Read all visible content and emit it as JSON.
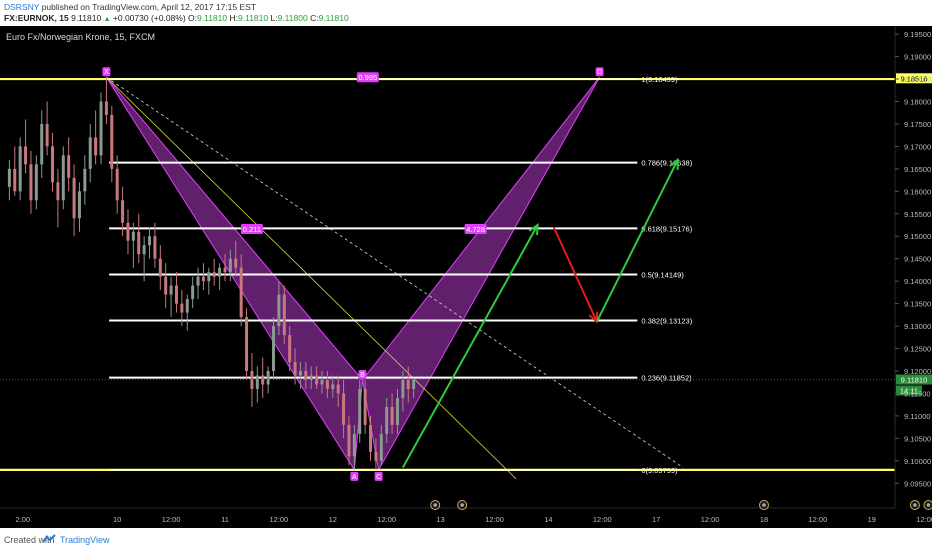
{
  "header": {
    "user": "DSRSNY",
    "published": "published on TradingView.com, April 12, 2017 17:15 EST",
    "symbol": "FX:EURNOK, 15",
    "last": "9.11810",
    "change": "+0.00730 (+0.08%)",
    "o_label": "O:",
    "o_value": "9.11810",
    "h_label": "H:",
    "h_value": "9.11810",
    "l_label": "L:",
    "l_value": "9.11800",
    "c_label": "C:",
    "c_value": "9.11810"
  },
  "footer": {
    "created_with": "Created with",
    "brand": "TradingView"
  },
  "colors": {
    "background": "#000000",
    "candle_up": "#8a9a92",
    "candle_down": "#c9787e",
    "pattern_fill": "#b03bc2",
    "pattern_line": "#e040fb",
    "level_white": "#ffffff",
    "level_yellow": "#ffff66",
    "arrow_green": "#2ecc40",
    "arrow_red": "#e21b1b",
    "price_tag": "#2a8c3a"
  },
  "chart_data": {
    "type": "candlestick",
    "title": "Euro Fx/Norwegian Krone, 15, FXCM",
    "price_axis": {
      "ylim": [
        9.0895,
        9.1968
      ],
      "ticks": [
        "9.19500",
        "9.19000",
        "9.18500",
        "9.18000",
        "9.17500",
        "9.17000",
        "9.16500",
        "9.16000",
        "9.15500",
        "9.15000",
        "9.14500",
        "9.14000",
        "9.13500",
        "9.13000",
        "9.12500",
        "9.12000",
        "9.11500",
        "9.11000",
        "9.10500",
        "9.10000",
        "9.09500"
      ],
      "tick_values": [
        9.195,
        9.19,
        9.185,
        9.18,
        9.175,
        9.17,
        9.165,
        9.16,
        9.155,
        9.15,
        9.145,
        9.14,
        9.135,
        9.13,
        9.125,
        9.12,
        9.115,
        9.11,
        9.105,
        9.1,
        9.095
      ],
      "current_price": "9.11810",
      "current_value": 9.1181,
      "top_level_tag": "9.18516",
      "top_level_value": 9.18516,
      "countdown": "14:11"
    },
    "time_axis": {
      "labels": [
        "2:00",
        "10",
        "12:00",
        "11",
        "12:00",
        "12",
        "12:00",
        "13",
        "12:00",
        "14",
        "12:00",
        "17",
        "12:00",
        "18",
        "12:00",
        "19",
        "12:00"
      ],
      "positions": [
        -1.5,
        2,
        4,
        6,
        8,
        10,
        12,
        14,
        16,
        18,
        20,
        22,
        24,
        26,
        28,
        30,
        32
      ]
    },
    "fibonacci_levels": [
      {
        "ratio": "1",
        "value": 9.18499,
        "label": "1(9.18499)"
      },
      {
        "ratio": "0.786",
        "value": 9.16638,
        "label": "0.786(9.16638)"
      },
      {
        "ratio": "0.618",
        "value": 9.15176,
        "label": "0.618(9.15176)"
      },
      {
        "ratio": "0.5",
        "value": 9.14149,
        "label": "0.5(9.14149)"
      },
      {
        "ratio": "0.382",
        "value": 9.13123,
        "label": "0.382(9.13123)"
      },
      {
        "ratio": "0.236",
        "value": 9.11852,
        "label": "0.236(9.11852)"
      },
      {
        "ratio": "0",
        "value": 9.09799,
        "label": "0(9.09799)"
      }
    ],
    "pattern_points": [
      {
        "name": "X",
        "t": 1.6,
        "price": 9.1854
      },
      {
        "name": "A",
        "t": 10.8,
        "price": 9.098
      },
      {
        "name": "B",
        "t": 11.1,
        "price": 9.118
      },
      {
        "name": "C",
        "t": 11.7,
        "price": 9.098
      },
      {
        "name": "D",
        "t": 19.9,
        "price": 9.1854
      }
    ],
    "pattern_ratios": [
      {
        "label": "0.211",
        "t": 7.0,
        "price": 9.1516
      },
      {
        "label": "4.728",
        "t": 15.3,
        "price": 9.1516
      },
      {
        "label": "0.995",
        "t": 11.3,
        "price": 9.1854
      }
    ],
    "arrows": [
      {
        "color": "green",
        "from": {
          "t": 12.6,
          "price": 9.0985
        },
        "to": {
          "t": 17.6,
          "price": 9.1525
        }
      },
      {
        "color": "red",
        "from": {
          "t": 18.2,
          "price": 9.152
        },
        "to": {
          "t": 19.8,
          "price": 9.131
        }
      },
      {
        "color": "green",
        "from": {
          "t": 19.8,
          "price": 9.131
        },
        "to": {
          "t": 22.8,
          "price": 9.167
        }
      }
    ],
    "trendlines": [
      {
        "style": "dashed",
        "from": {
          "t": 1.6,
          "price": 9.1854
        },
        "to": {
          "t": 23.0,
          "price": 9.0985
        }
      },
      {
        "style": "solid",
        "from": {
          "t": 1.6,
          "price": 9.1854
        },
        "to": {
          "t": 16.8,
          "price": 9.096
        }
      }
    ],
    "candles": [
      {
        "t": -2.0,
        "o": 9.161,
        "h": 9.167,
        "l": 9.158,
        "c": 9.165
      },
      {
        "t": -1.8,
        "o": 9.165,
        "h": 9.17,
        "l": 9.159,
        "c": 9.16
      },
      {
        "t": -1.6,
        "o": 9.16,
        "h": 9.172,
        "l": 9.158,
        "c": 9.17
      },
      {
        "t": -1.4,
        "o": 9.17,
        "h": 9.176,
        "l": 9.164,
        "c": 9.166
      },
      {
        "t": -1.2,
        "o": 9.166,
        "h": 9.169,
        "l": 9.155,
        "c": 9.158
      },
      {
        "t": -1.0,
        "o": 9.158,
        "h": 9.168,
        "l": 9.156,
        "c": 9.166
      },
      {
        "t": -0.8,
        "o": 9.166,
        "h": 9.178,
        "l": 9.163,
        "c": 9.175
      },
      {
        "t": -0.6,
        "o": 9.175,
        "h": 9.18,
        "l": 9.168,
        "c": 9.17
      },
      {
        "t": -0.4,
        "o": 9.17,
        "h": 9.173,
        "l": 9.16,
        "c": 9.162
      },
      {
        "t": -0.2,
        "o": 9.162,
        "h": 9.165,
        "l": 9.152,
        "c": 9.158
      },
      {
        "t": 0.0,
        "o": 9.158,
        "h": 9.17,
        "l": 9.156,
        "c": 9.168
      },
      {
        "t": 0.2,
        "o": 9.168,
        "h": 9.172,
        "l": 9.16,
        "c": 9.163
      },
      {
        "t": 0.4,
        "o": 9.163,
        "h": 9.166,
        "l": 9.15,
        "c": 9.154
      },
      {
        "t": 0.6,
        "o": 9.154,
        "h": 9.162,
        "l": 9.151,
        "c": 9.16
      },
      {
        "t": 0.8,
        "o": 9.16,
        "h": 9.168,
        "l": 9.157,
        "c": 9.165
      },
      {
        "t": 1.0,
        "o": 9.165,
        "h": 9.175,
        "l": 9.162,
        "c": 9.172
      },
      {
        "t": 1.2,
        "o": 9.172,
        "h": 9.178,
        "l": 9.166,
        "c": 9.168
      },
      {
        "t": 1.4,
        "o": 9.168,
        "h": 9.182,
        "l": 9.166,
        "c": 9.18
      },
      {
        "t": 1.6,
        "o": 9.18,
        "h": 9.1854,
        "l": 9.175,
        "c": 9.177
      },
      {
        "t": 1.8,
        "o": 9.177,
        "h": 9.179,
        "l": 9.162,
        "c": 9.165
      },
      {
        "t": 2.0,
        "o": 9.165,
        "h": 9.168,
        "l": 9.155,
        "c": 9.158
      },
      {
        "t": 2.2,
        "o": 9.158,
        "h": 9.161,
        "l": 9.15,
        "c": 9.153
      },
      {
        "t": 2.4,
        "o": 9.153,
        "h": 9.156,
        "l": 9.146,
        "c": 9.149
      },
      {
        "t": 2.6,
        "o": 9.149,
        "h": 9.153,
        "l": 9.143,
        "c": 9.151
      },
      {
        "t": 2.8,
        "o": 9.151,
        "h": 9.155,
        "l": 9.144,
        "c": 9.146
      },
      {
        "t": 3.0,
        "o": 9.146,
        "h": 9.15,
        "l": 9.14,
        "c": 9.148
      },
      {
        "t": 3.2,
        "o": 9.148,
        "h": 9.152,
        "l": 9.145,
        "c": 9.15
      },
      {
        "t": 3.4,
        "o": 9.15,
        "h": 9.153,
        "l": 9.143,
        "c": 9.145
      },
      {
        "t": 3.6,
        "o": 9.145,
        "h": 9.148,
        "l": 9.138,
        "c": 9.141
      },
      {
        "t": 3.8,
        "o": 9.141,
        "h": 9.144,
        "l": 9.134,
        "c": 9.137
      },
      {
        "t": 4.0,
        "o": 9.137,
        "h": 9.141,
        "l": 9.132,
        "c": 9.139
      },
      {
        "t": 4.2,
        "o": 9.139,
        "h": 9.142,
        "l": 9.133,
        "c": 9.135
      },
      {
        "t": 4.4,
        "o": 9.135,
        "h": 9.138,
        "l": 9.13,
        "c": 9.133
      },
      {
        "t": 4.6,
        "o": 9.133,
        "h": 9.137,
        "l": 9.129,
        "c": 9.136
      },
      {
        "t": 4.8,
        "o": 9.136,
        "h": 9.141,
        "l": 9.134,
        "c": 9.139
      },
      {
        "t": 5.0,
        "o": 9.139,
        "h": 9.143,
        "l": 9.136,
        "c": 9.141
      },
      {
        "t": 5.2,
        "o": 9.141,
        "h": 9.144,
        "l": 9.138,
        "c": 9.14
      },
      {
        "t": 5.4,
        "o": 9.14,
        "h": 9.143,
        "l": 9.137,
        "c": 9.142
      },
      {
        "t": 5.6,
        "o": 9.142,
        "h": 9.145,
        "l": 9.139,
        "c": 9.141
      },
      {
        "t": 5.8,
        "o": 9.141,
        "h": 9.144,
        "l": 9.138,
        "c": 9.143
      },
      {
        "t": 6.0,
        "o": 9.143,
        "h": 9.146,
        "l": 9.14,
        "c": 9.142
      },
      {
        "t": 6.2,
        "o": 9.142,
        "h": 9.147,
        "l": 9.14,
        "c": 9.145
      },
      {
        "t": 6.4,
        "o": 9.145,
        "h": 9.149,
        "l": 9.141,
        "c": 9.143
      },
      {
        "t": 6.6,
        "o": 9.143,
        "h": 9.146,
        "l": 9.13,
        "c": 9.132
      },
      {
        "t": 6.8,
        "o": 9.132,
        "h": 9.134,
        "l": 9.118,
        "c": 9.12
      },
      {
        "t": 7.0,
        "o": 9.12,
        "h": 9.124,
        "l": 9.112,
        "c": 9.116
      },
      {
        "t": 7.2,
        "o": 9.116,
        "h": 9.121,
        "l": 9.113,
        "c": 9.119
      },
      {
        "t": 7.4,
        "o": 9.119,
        "h": 9.123,
        "l": 9.114,
        "c": 9.117
      },
      {
        "t": 7.6,
        "o": 9.117,
        "h": 9.121,
        "l": 9.115,
        "c": 9.12
      },
      {
        "t": 7.8,
        "o": 9.12,
        "h": 9.132,
        "l": 9.118,
        "c": 9.13
      },
      {
        "t": 8.0,
        "o": 9.13,
        "h": 9.14,
        "l": 9.128,
        "c": 9.137
      },
      {
        "t": 8.2,
        "o": 9.137,
        "h": 9.139,
        "l": 9.126,
        "c": 9.128
      },
      {
        "t": 8.4,
        "o": 9.128,
        "h": 9.13,
        "l": 9.12,
        "c": 9.122
      },
      {
        "t": 8.6,
        "o": 9.122,
        "h": 9.125,
        "l": 9.117,
        "c": 9.119
      },
      {
        "t": 8.8,
        "o": 9.119,
        "h": 9.122,
        "l": 9.116,
        "c": 9.12
      },
      {
        "t": 9.0,
        "o": 9.12,
        "h": 9.122,
        "l": 9.116,
        "c": 9.118
      },
      {
        "t": 9.2,
        "o": 9.118,
        "h": 9.121,
        "l": 9.116,
        "c": 9.119
      },
      {
        "t": 9.4,
        "o": 9.119,
        "h": 9.121,
        "l": 9.116,
        "c": 9.117
      },
      {
        "t": 9.6,
        "o": 9.117,
        "h": 9.12,
        "l": 9.115,
        "c": 9.118
      },
      {
        "t": 9.8,
        "o": 9.118,
        "h": 9.12,
        "l": 9.114,
        "c": 9.116
      },
      {
        "t": 10.0,
        "o": 9.116,
        "h": 9.119,
        "l": 9.114,
        "c": 9.117
      },
      {
        "t": 10.2,
        "o": 9.117,
        "h": 9.119,
        "l": 9.112,
        "c": 9.115
      },
      {
        "t": 10.4,
        "o": 9.115,
        "h": 9.118,
        "l": 9.105,
        "c": 9.108
      },
      {
        "t": 10.6,
        "o": 9.108,
        "h": 9.11,
        "l": 9.099,
        "c": 9.101
      },
      {
        "t": 10.8,
        "o": 9.101,
        "h": 9.108,
        "l": 9.098,
        "c": 9.106
      },
      {
        "t": 11.0,
        "o": 9.106,
        "h": 9.118,
        "l": 9.104,
        "c": 9.116
      },
      {
        "t": 11.2,
        "o": 9.116,
        "h": 9.118,
        "l": 9.106,
        "c": 9.108
      },
      {
        "t": 11.4,
        "o": 9.108,
        "h": 9.11,
        "l": 9.1,
        "c": 9.102
      },
      {
        "t": 11.6,
        "o": 9.102,
        "h": 9.105,
        "l": 9.098,
        "c": 9.1
      },
      {
        "t": 11.8,
        "o": 9.1,
        "h": 9.108,
        "l": 9.099,
        "c": 9.106
      },
      {
        "t": 12.0,
        "o": 9.106,
        "h": 9.114,
        "l": 9.104,
        "c": 9.112
      },
      {
        "t": 12.2,
        "o": 9.112,
        "h": 9.115,
        "l": 9.106,
        "c": 9.108
      },
      {
        "t": 12.4,
        "o": 9.108,
        "h": 9.116,
        "l": 9.106,
        "c": 9.114
      },
      {
        "t": 12.6,
        "o": 9.114,
        "h": 9.12,
        "l": 9.111,
        "c": 9.118
      },
      {
        "t": 12.8,
        "o": 9.118,
        "h": 9.121,
        "l": 9.113,
        "c": 9.116
      },
      {
        "t": 13.0,
        "o": 9.116,
        "h": 9.1185,
        "l": 9.114,
        "c": 9.1181
      }
    ]
  }
}
